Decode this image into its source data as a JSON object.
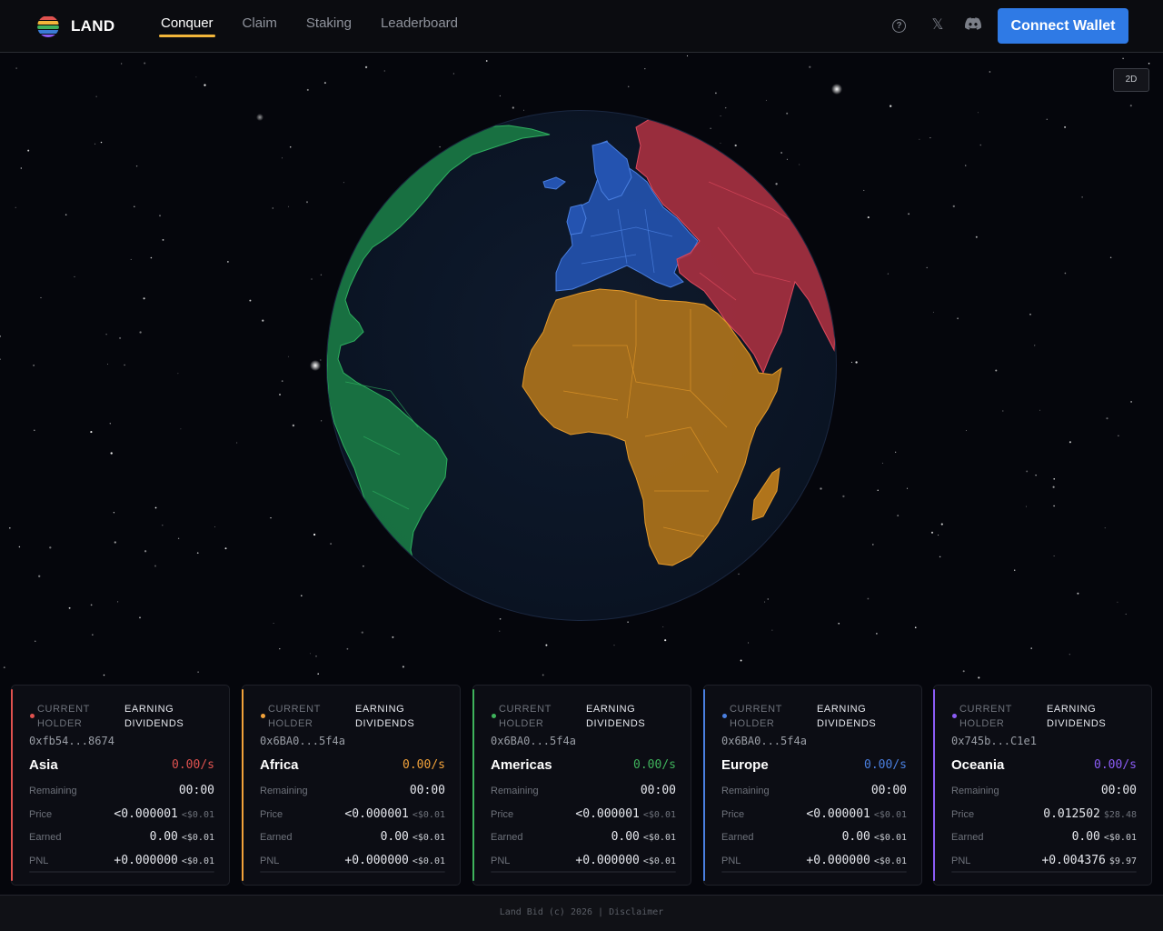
{
  "app": {
    "brand": "LAND",
    "logo_colors": [
      "#e0524f",
      "#f2b63a",
      "#3fb35c",
      "#3a7bd5",
      "#8b5cf6"
    ]
  },
  "nav": {
    "items": [
      {
        "label": "Conquer",
        "active": true
      },
      {
        "label": "Claim",
        "active": false
      },
      {
        "label": "Staking",
        "active": false
      },
      {
        "label": "Leaderboard",
        "active": false
      }
    ]
  },
  "header": {
    "icons": [
      "help-icon",
      "x-icon",
      "discord-icon"
    ],
    "connect_label": "Connect Wallet"
  },
  "map": {
    "view_toggle": "2D",
    "view_mode": "3D globe",
    "regions": [
      {
        "name": "Asia",
        "color": "#c0394a"
      },
      {
        "name": "Africa",
        "color": "#d48a1c"
      },
      {
        "name": "Americas",
        "color": "#1f8a4e"
      },
      {
        "name": "Europe",
        "color": "#2a5ab8"
      }
    ],
    "ocean_color": "#0d1828"
  },
  "labels": {
    "current_holder": "CURRENT HOLDER",
    "earning_dividends": "EARNING DIVIDENDS",
    "remaining": "Remaining",
    "price": "Price",
    "earned": "Earned",
    "pnl": "PNL"
  },
  "cards": [
    {
      "region": "Asia",
      "color": "#e0524f",
      "holder": "0xfb54...8674",
      "rate": "0.00/s",
      "remaining": "00:00",
      "price": "<0.000001",
      "price_usd": "<$0.01",
      "earned": "0.00",
      "earned_usd": "<$0.01",
      "pnl": "+0.000000",
      "pnl_usd": "<$0.01"
    },
    {
      "region": "Africa",
      "color": "#f2a23a",
      "holder": "0x6BA0...5f4a",
      "rate": "0.00/s",
      "remaining": "00:00",
      "price": "<0.000001",
      "price_usd": "<$0.01",
      "earned": "0.00",
      "earned_usd": "<$0.01",
      "pnl": "+0.000000",
      "pnl_usd": "<$0.01"
    },
    {
      "region": "Americas",
      "color": "#3fb35c",
      "holder": "0x6BA0...5f4a",
      "rate": "0.00/s",
      "remaining": "00:00",
      "price": "<0.000001",
      "price_usd": "<$0.01",
      "earned": "0.00",
      "earned_usd": "<$0.01",
      "pnl": "+0.000000",
      "pnl_usd": "<$0.01"
    },
    {
      "region": "Europe",
      "color": "#4a7fe0",
      "holder": "0x6BA0...5f4a",
      "rate": "0.00/s",
      "remaining": "00:00",
      "price": "<0.000001",
      "price_usd": "<$0.01",
      "earned": "0.00",
      "earned_usd": "<$0.01",
      "pnl": "+0.000000",
      "pnl_usd": "<$0.01"
    },
    {
      "region": "Oceania",
      "color": "#8b5cf6",
      "holder": "0x745b...C1e1",
      "rate": "0.00/s",
      "remaining": "00:00",
      "price": "0.012502",
      "price_usd": "$28.48",
      "earned": "0.00",
      "earned_usd": "<$0.01",
      "pnl": "+0.004376",
      "pnl_usd": "$9.97"
    }
  ],
  "footer": {
    "copyright": "Land Bid (c) 2026",
    "separator": "|",
    "disclaimer": "Disclaimer"
  }
}
